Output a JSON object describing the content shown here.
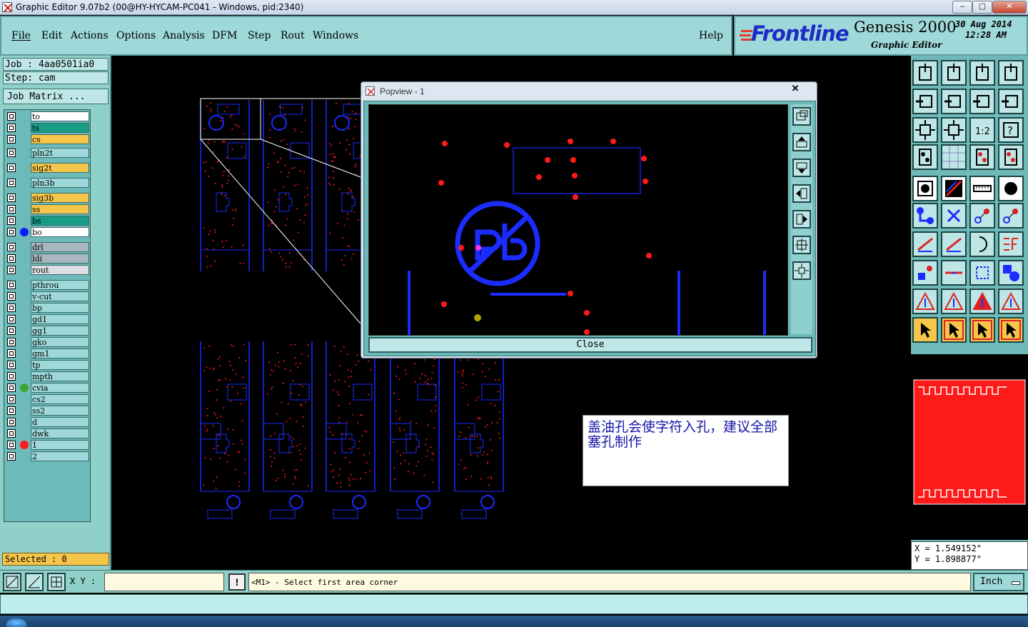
{
  "window": {
    "title": "Graphic Editor 9.07b2 (00@HY-HYCAM-PC041 - Windows, pid:2340)",
    "controls": [
      "–",
      "▢",
      "✕"
    ]
  },
  "menu": {
    "items": [
      "File",
      "Edit",
      "Actions",
      "Options",
      "Analysis",
      "DFM",
      "Step",
      "Rout",
      "Windows"
    ],
    "help": "Help"
  },
  "brand": {
    "logo": "Frontline",
    "product": "Genesis 2000",
    "subtitle": "Graphic Editor",
    "date": "30 Aug 2014",
    "time": "12:28 AM"
  },
  "job": {
    "job_label": "Job : 4aa0501ia0",
    "step_label": "Step: cam",
    "matrix_button": "Job Matrix ..."
  },
  "layers": [
    {
      "name": "to",
      "color": "#ffffff",
      "dot": ""
    },
    {
      "name": "ts",
      "color": "#179c85",
      "dot": ""
    },
    {
      "name": "cs",
      "color": "#f6c64a",
      "dot": ""
    },
    {
      "name": "pln2t",
      "color": "#9ed8d8",
      "dot": ""
    },
    {
      "name": "sig2t",
      "color": "#f6c64a",
      "dot": ""
    },
    {
      "name": "pln3b",
      "color": "#9ed8d8",
      "dot": ""
    },
    {
      "name": "sig3b",
      "color": "#f6c64a",
      "dot": ""
    },
    {
      "name": "ss",
      "color": "#f6c64a",
      "dot": ""
    },
    {
      "name": "bs",
      "color": "#179c85",
      "dot": ""
    },
    {
      "name": "bo",
      "color": "#ffffff",
      "dot": "#0a1cff"
    },
    {
      "name": "drl",
      "color": "#a9b8c0",
      "dot": ""
    },
    {
      "name": "ldi",
      "color": "#a9b8c0",
      "dot": ""
    },
    {
      "name": "rout",
      "color": "#d9dfe2",
      "dot": ""
    },
    {
      "name": "pthrou",
      "color": "#9ed8d8",
      "dot": ""
    },
    {
      "name": "v-cut",
      "color": "#9ed8d8",
      "dot": ""
    },
    {
      "name": "bp",
      "color": "#9ed8d8",
      "dot": ""
    },
    {
      "name": "gd1",
      "color": "#9ed8d8",
      "dot": ""
    },
    {
      "name": "gg1",
      "color": "#9ed8d8",
      "dot": ""
    },
    {
      "name": "gko",
      "color": "#9ed8d8",
      "dot": ""
    },
    {
      "name": "gm1",
      "color": "#9ed8d8",
      "dot": ""
    },
    {
      "name": "tp",
      "color": "#9ed8d8",
      "dot": ""
    },
    {
      "name": "mpth",
      "color": "#9ed8d8",
      "dot": ""
    },
    {
      "name": "cvia",
      "color": "#9ed8d8",
      "dot": "#3aa632"
    },
    {
      "name": "cs2",
      "color": "#9ed8d8",
      "dot": ""
    },
    {
      "name": "ss2",
      "color": "#9ed8d8",
      "dot": ""
    },
    {
      "name": "d",
      "color": "#9ed8d8",
      "dot": ""
    },
    {
      "name": "dwk",
      "color": "#9ed8d8",
      "dot": ""
    },
    {
      "name": "1",
      "color": "#9ed8d8",
      "dot": "#ff1a1a"
    },
    {
      "name": "2",
      "color": "#9ed8d8",
      "dot": ""
    }
  ],
  "selected": "Selected : 0",
  "popview": {
    "title": "Popview - 1",
    "close_x": "✕",
    "close_button": "Close"
  },
  "note": "盖油孔会使字符入孔，建议全部塞孔制作",
  "coords": {
    "x": "X  =  1.549152\"",
    "y": "Y  =  1.898877\""
  },
  "command": {
    "xy_label": "X Y :",
    "xy_value": "",
    "prompt": "<M1> - Select first area corner",
    "warn_icon": "!",
    "units": "Inch"
  },
  "colors": {
    "panel": "#8fd0c8",
    "board_features": "#1a2cff",
    "pads": "#ff1a1a"
  }
}
